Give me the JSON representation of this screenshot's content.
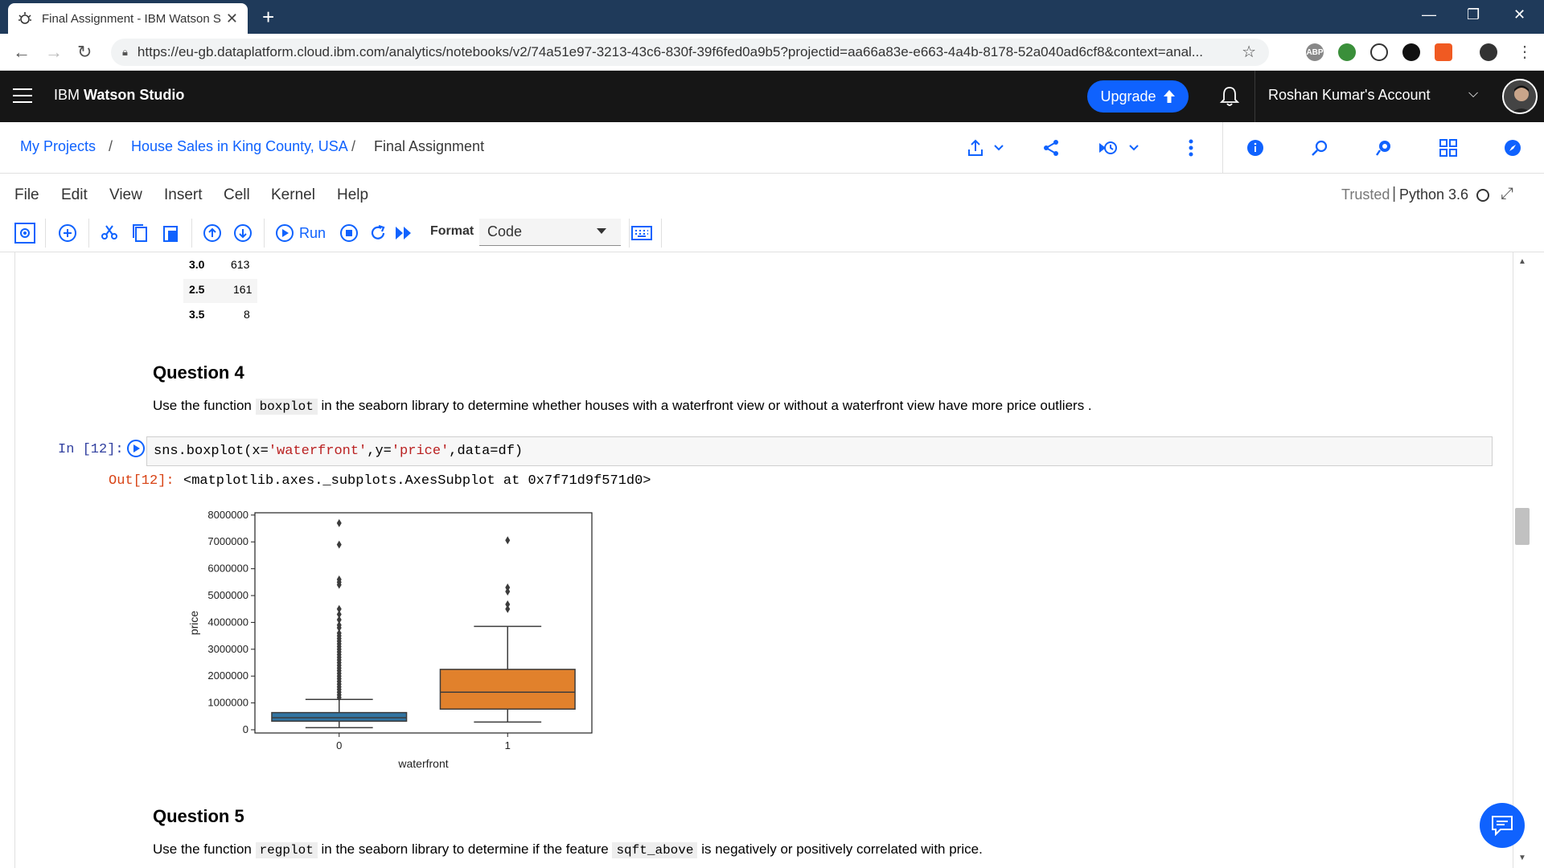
{
  "browser": {
    "tab_title": "Final Assignment - IBM Watson S",
    "url": "https://eu-gb.dataplatform.cloud.ibm.com/analytics/notebooks/v2/74a51e97-3213-43c6-830f-39f6fed0a9b5?projectid=aa66a83e-e663-4a4b-8178-52a040ad6cf8&context=anal..."
  },
  "header": {
    "brand_prefix": "IBM ",
    "brand_bold": "Watson Studio",
    "upgrade_label": "Upgrade",
    "account": "Roshan Kumar's Account"
  },
  "breadcrumb": {
    "items": [
      "My Projects",
      "House Sales in King County, USA",
      "Final Assignment"
    ],
    "separator": "/"
  },
  "menubar": {
    "items": [
      "File",
      "Edit",
      "View",
      "Insert",
      "Cell",
      "Kernel",
      "Help"
    ],
    "trusted": "Trusted",
    "kernel": "Python 3.6"
  },
  "toolbar": {
    "run_label": "Run",
    "format_label": "Format",
    "format_value": "Code"
  },
  "value_counts": [
    {
      "key": "3.0",
      "count": "613"
    },
    {
      "key": "2.5",
      "count": "161"
    },
    {
      "key": "3.5",
      "count": "8"
    }
  ],
  "question4": {
    "title": "Question 4",
    "text_before": "Use the function ",
    "code": "boxplot",
    "text_after": " in the seaborn library to determine whether houses with a waterfront view or without a waterfront view have more price outliers ."
  },
  "cell12": {
    "in_prompt": "In [12]:",
    "code_fn": "sns.boxplot(x=",
    "code_s1": "'waterfront'",
    "code_mid1": ",y=",
    "code_s2": "'price'",
    "code_mid2": ",data=df)",
    "out_prompt": "Out[12]:",
    "output": "<matplotlib.axes._subplots.AxesSubplot at 0x7f71d9f571d0>"
  },
  "question5": {
    "title": "Question 5",
    "text_before": "Use the function ",
    "code1": "regplot",
    "text_mid": " in the seaborn library to determine if the feature ",
    "code2": "sqft_above",
    "text_after": " is negatively or positively correlated with price."
  },
  "chart_data": {
    "type": "box",
    "xlabel": "waterfront",
    "ylabel": "price",
    "ylim": [
      0,
      8000000
    ],
    "yticks": [
      0,
      1000000,
      2000000,
      3000000,
      4000000,
      5000000,
      6000000,
      7000000,
      8000000
    ],
    "ytick_labels": [
      "0",
      "1000000",
      "2000000",
      "3000000",
      "4000000",
      "5000000",
      "6000000",
      "7000000",
      "8000000"
    ],
    "categories": [
      "0",
      "1"
    ],
    "boxes": [
      {
        "category": "0",
        "color": "#3274a1",
        "whisker_low": 80000,
        "q1": 320000,
        "median": 450000,
        "q3": 640000,
        "whisker_high": 1130000,
        "outliers": [
          7700000,
          6900000,
          5600000,
          5500000,
          5400000,
          4500000,
          4300000,
          4100000,
          3900000,
          3800000,
          3600000,
          3500000,
          3400000,
          3300000,
          3200000,
          3100000,
          3000000,
          2900000,
          2800000,
          2700000,
          2600000,
          2500000,
          2400000,
          2300000,
          2200000,
          2100000,
          2000000,
          1900000,
          1800000,
          1700000,
          1600000,
          1500000,
          1400000,
          1300000,
          1200000
        ]
      },
      {
        "category": "1",
        "color": "#e1812c",
        "whisker_low": 290000,
        "q1": 770000,
        "median": 1400000,
        "q3": 2250000,
        "whisker_high": 3850000,
        "outliers": [
          7060000,
          5300000,
          5150000,
          4670000,
          4500000
        ]
      }
    ]
  }
}
